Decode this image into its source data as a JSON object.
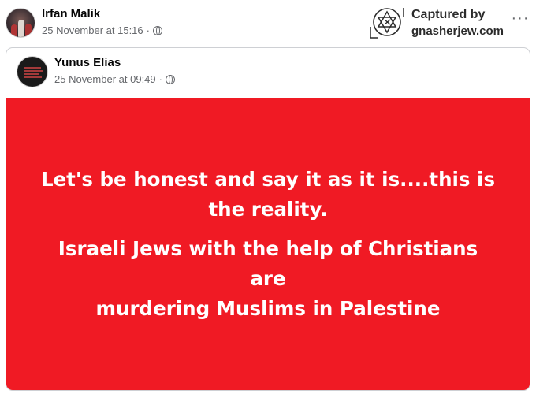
{
  "outer_post": {
    "author": "Irfan Malik",
    "timestamp": "25 November at 15:16",
    "separator": "·",
    "more_label": "···"
  },
  "watermark": {
    "line1": "Captured by",
    "line2": "gnasherjew.com"
  },
  "shared_post": {
    "author": "Yunus Elias",
    "timestamp": "25 November at 09:49",
    "separator": "·",
    "background_color": "#f01a24",
    "text_lines": [
      "Let's be honest and say it as it is....this is",
      "the reality.",
      "Israeli Jews with the help of Christians are",
      "murdering Muslims in Palestine"
    ]
  }
}
